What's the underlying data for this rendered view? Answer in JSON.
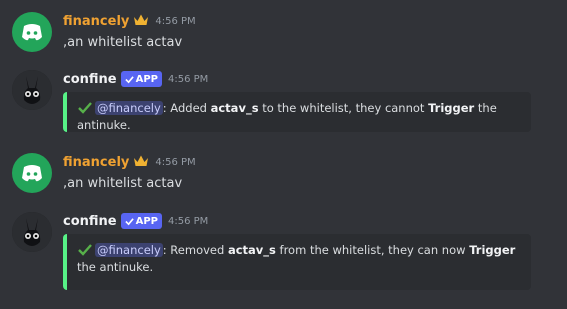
{
  "messages": [
    {
      "author": "financely",
      "time": "4:56 PM",
      "text": ",an whitelist actav"
    },
    {
      "author": "confine",
      "badge": "APP",
      "time": "4:56 PM",
      "embed": {
        "mention": "@financely",
        "pre": ": Added ",
        "target": "actav_s",
        "mid": " to the whitelist, they cannot ",
        "trigger": "Trigger",
        "post": " the antinuke."
      }
    },
    {
      "author": "financely",
      "time": "4:56 PM",
      "text": ",an whitelist actav"
    },
    {
      "author": "confine",
      "badge": "APP",
      "time": "4:56 PM",
      "embed": {
        "mention": "@financely",
        "pre": ": Removed ",
        "target": "actav_s",
        "mid": " from the whitelist, they can now ",
        "trigger": "Trigger",
        "post": " the antinuke."
      }
    }
  ],
  "colors": {
    "background": "#313338",
    "user_name": "#f0a232",
    "accent": "#5865f2",
    "embed_border": "#57f287"
  },
  "icons": [
    "discord-icon",
    "crown-icon",
    "verified-check-icon",
    "check-icon"
  ]
}
